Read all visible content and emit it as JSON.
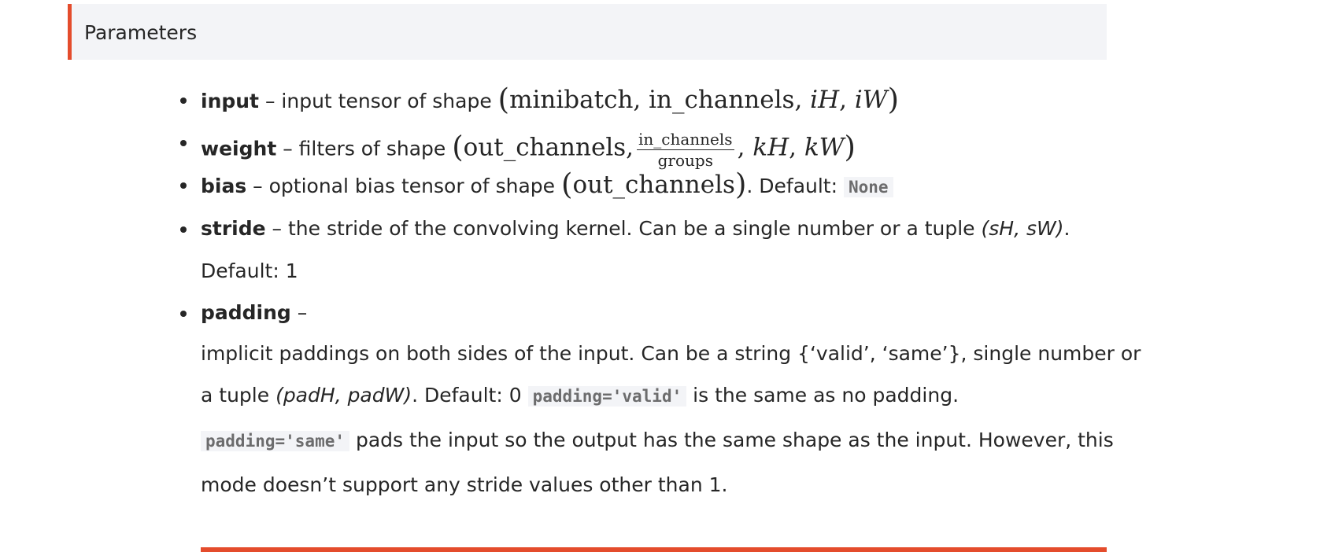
{
  "header": {
    "title": "Parameters"
  },
  "params": {
    "input": {
      "name": "input",
      "desc": " – input tensor of shape ",
      "shape_a": "minibatch",
      "shape_b": "in_channels",
      "shape_c": "iH",
      "shape_d": "iW"
    },
    "weight": {
      "name": "weight",
      "desc": " – filters of shape ",
      "shape_a": "out_channels",
      "frac_num": "in_channels",
      "frac_den": "groups",
      "shape_c": "kH",
      "shape_d": "kW"
    },
    "bias": {
      "name": "bias",
      "desc": " – optional bias tensor of shape ",
      "shape_a": "out_channels",
      "default_label": ". Default: ",
      "default_code": "None"
    },
    "stride": {
      "name": "stride",
      "desc": " – the stride of the convolving kernel. Can be a single number or a tuple ",
      "tuple": "(sH, sW)",
      "tail": ".",
      "line2": "Default: 1"
    },
    "padding": {
      "name": "padding",
      "dash": " –",
      "line1": "implicit paddings on both sides of the input. Can be a string {‘valid’, ‘same’}, single number or",
      "line2_a": "a tuple ",
      "line2_tuple": "(padH, padW)",
      "line2_b": ". Default: 0 ",
      "line2_code": "padding='valid'",
      "line2_c": " is the same as no padding.",
      "line3_code": "padding='same'",
      "line3_b": " pads the input so the output has the same shape as the input. However, this",
      "line4": "mode doesn’t support any stride values other than 1."
    }
  }
}
